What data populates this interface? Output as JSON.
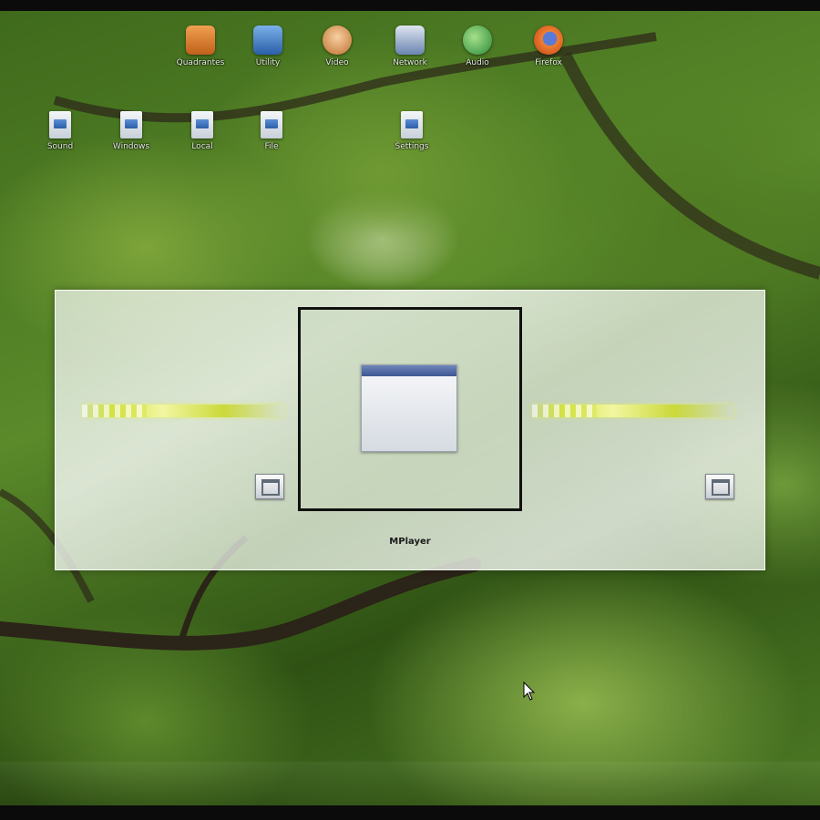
{
  "desktop": {
    "top_row_icons": [
      {
        "label": "Quadrantes",
        "icon": "app-orange-icon",
        "color": "#d8782a"
      },
      {
        "label": "Utility",
        "icon": "app-blue-icon",
        "color": "#3a78c8"
      },
      {
        "label": "Video",
        "icon": "app-vlc-icon",
        "color": "#e09040"
      },
      {
        "label": "Network",
        "icon": "app-network-icon",
        "color": "#5a7ab0"
      },
      {
        "label": "Audio",
        "icon": "app-green-icon",
        "color": "#3ca84a"
      },
      {
        "label": "Firefox",
        "icon": "firefox-icon",
        "color": "#e0602a"
      }
    ],
    "second_row_icons": [
      {
        "label": "Sound",
        "icon": "file-icon"
      },
      {
        "label": "Windows",
        "icon": "file-icon"
      },
      {
        "label": "Local",
        "icon": "file-icon"
      },
      {
        "label": "File",
        "icon": "file-icon"
      },
      {
        "label": "Settings",
        "icon": "file-icon"
      }
    ]
  },
  "switcher": {
    "caption": "MPlayer",
    "left_progress": 0.32,
    "right_progress": 0.32
  },
  "colors": {
    "selection_border": "#111111",
    "progress_accent": "#d7e44a"
  }
}
